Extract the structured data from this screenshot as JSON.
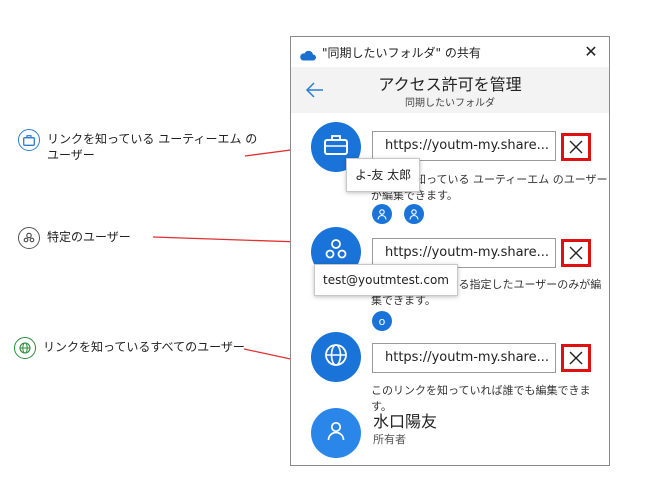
{
  "annotations": {
    "company_link": "リンクを知っている ユーティーエム の\nユーザー",
    "specific_users": "特定のユーザー",
    "anyone_link": "リンクを知っているすべてのユーザー"
  },
  "dialog": {
    "title": "\"同期したいフォルダ\" の共有",
    "header_title": "アクセス許可を管理",
    "header_subtitle": "同期したいフォルダ"
  },
  "links": [
    {
      "url": "https://youtm-my.share...",
      "description": "リンクを知っている ユーティーエム のユーザー\nが編集できます。",
      "tooltip": "よ-友 太郎"
    },
    {
      "url": "https://youtm-my.share...",
      "description": "リンクを知っている指定したユーザーのみが編\n集できます。",
      "tooltip": "test@youtmtest.com",
      "user_initial": "o"
    },
    {
      "url": "https://youtm-my.share...",
      "description": "このリンクを知っていれば誰でも編集できます。"
    }
  ],
  "owner": {
    "name": "水口陽友",
    "role": "所有者"
  },
  "colors": {
    "accent": "#1a73d8",
    "highlight": "#e01010",
    "arrow": "#e03030"
  }
}
